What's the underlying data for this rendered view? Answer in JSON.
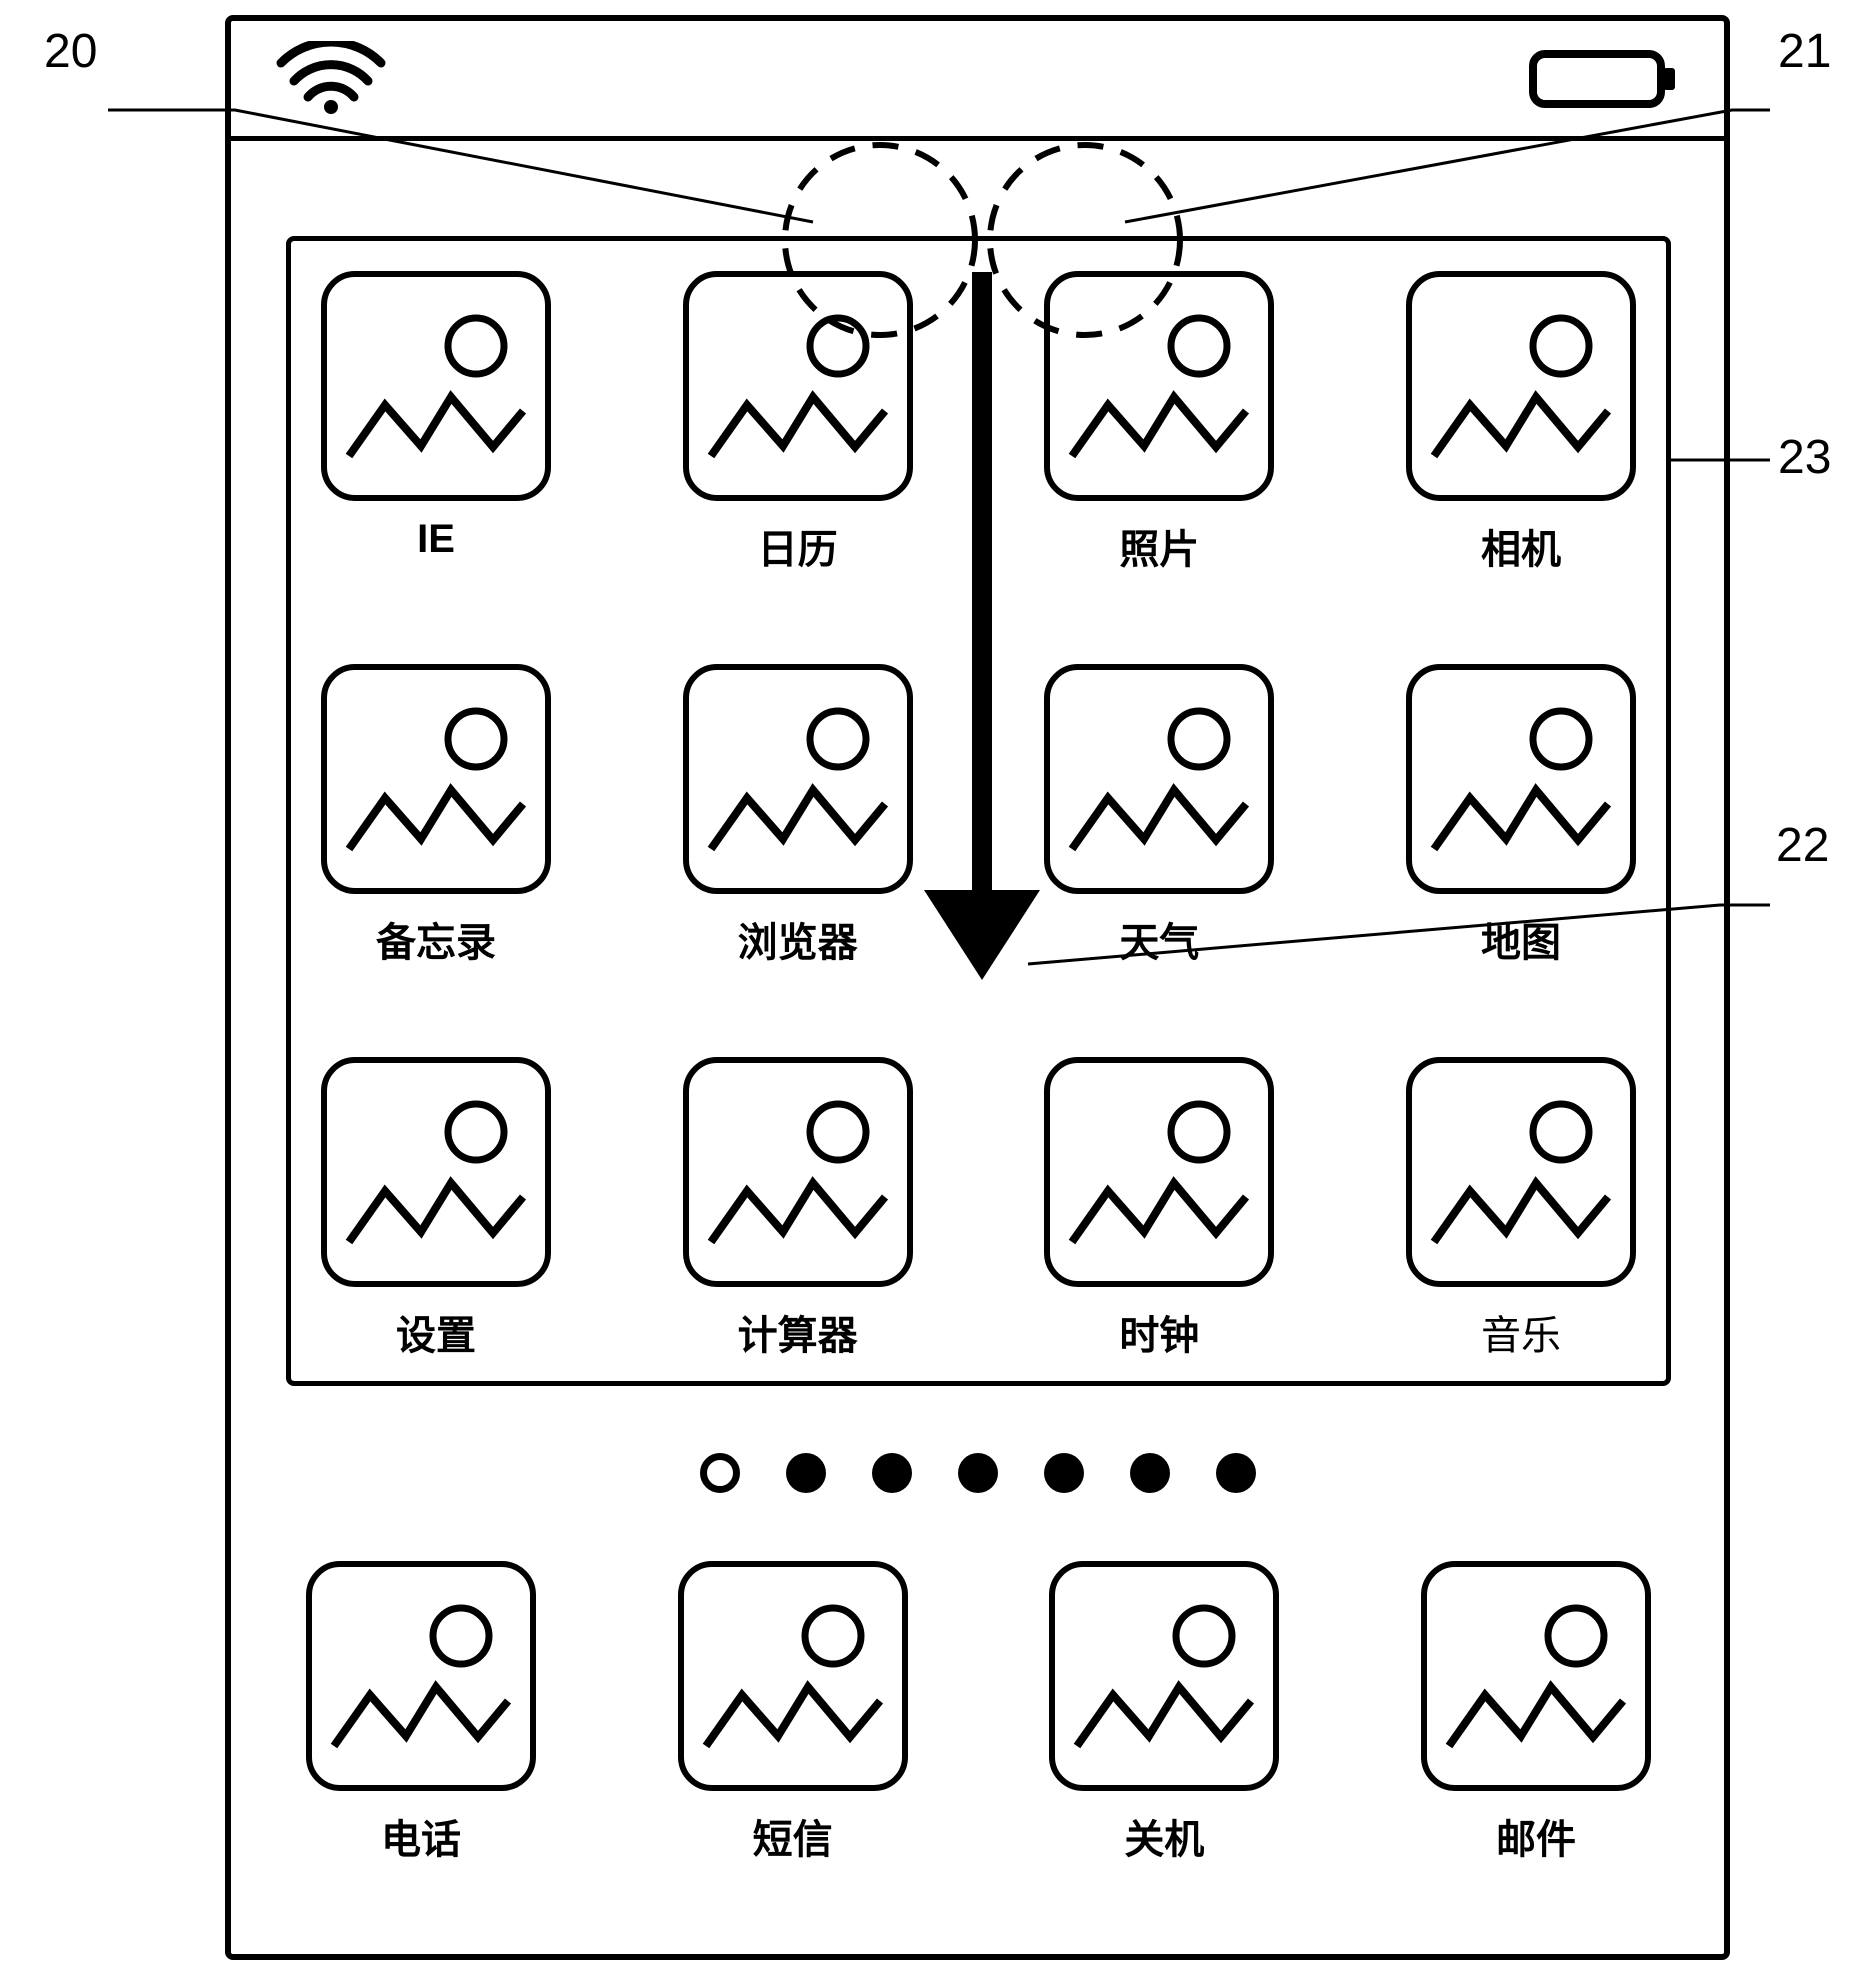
{
  "callouts": {
    "c20": "20",
    "c21": "21",
    "c22": "22",
    "c23": "23"
  },
  "status": {
    "wifi": "wifi-icon",
    "battery": "battery-icon"
  },
  "apps": {
    "rows": [
      [
        {
          "label": "IE"
        },
        {
          "label": "日历"
        },
        {
          "label": "照片"
        },
        {
          "label": "相机"
        }
      ],
      [
        {
          "label": "备忘录"
        },
        {
          "label": "浏览器"
        },
        {
          "label": "天气"
        },
        {
          "label": "地图"
        }
      ],
      [
        {
          "label": "设置"
        },
        {
          "label": "计算器"
        },
        {
          "label": "时钟"
        },
        {
          "label": "音乐"
        }
      ]
    ]
  },
  "page_indicator": {
    "count": 7,
    "active_index": 0
  },
  "dock": [
    {
      "label": "电话"
    },
    {
      "label": "短信"
    },
    {
      "label": "关机"
    },
    {
      "label": "邮件"
    }
  ],
  "gesture": {
    "touch_points": 2,
    "direction": "down"
  }
}
